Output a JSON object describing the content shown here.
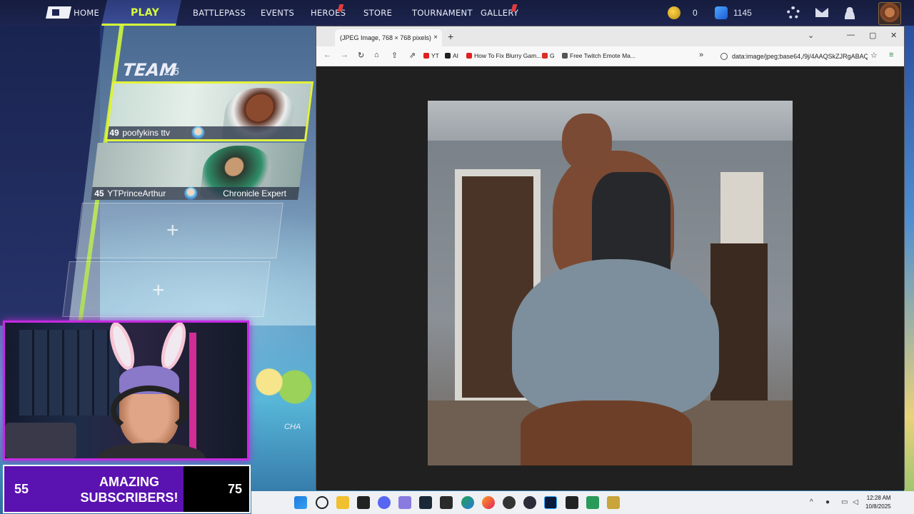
{
  "nav": {
    "home": "HOME",
    "play": "PLAY",
    "battlepass": "BATTLEPASS",
    "events": "EVENTS",
    "heroes": "HEROES",
    "store": "STORE",
    "tournament": "TOURNAMENT",
    "gallery": "GALLERY",
    "currency_gold": "0",
    "currency_gems": "1145",
    "accent_color": "#d8ff3a"
  },
  "team": {
    "title": "TEAM",
    "count": "2/6",
    "members": [
      {
        "level": "49",
        "name": "poofykins ttv",
        "tag": ""
      },
      {
        "level": "45",
        "name": "YTPrinceArthur",
        "tag": "Chronicle Expert"
      }
    ]
  },
  "game": {
    "change_label": "CHA"
  },
  "subscribers": {
    "current": "55",
    "goal": "75",
    "label_line1": "AMAZING",
    "label_line2": "SUBSCRIBERS!",
    "progress_fraction": 0.733,
    "fill_color": "#5a12b0"
  },
  "browser": {
    "tab_title": "(JPEG Image, 768 × 768 pixels)",
    "tab_close": "×",
    "new_tab": "+",
    "bookmarks": [
      {
        "label": "YT",
        "color": "#e01f1f"
      },
      {
        "label": "AI",
        "color": "#222222"
      },
      {
        "label": "How To Fix Blurry Gam...",
        "color": "#e01f1f"
      },
      {
        "label": "G",
        "color": "#d93025"
      },
      {
        "label": "Free Twitch Emote Ma...",
        "color": "#555555"
      }
    ],
    "address": "data:image/jpeg;base64,/9j/4AAQSkZJRgABAQ"
  },
  "taskbar": {
    "time": "12:28 AM",
    "date": "10/8/2025"
  }
}
